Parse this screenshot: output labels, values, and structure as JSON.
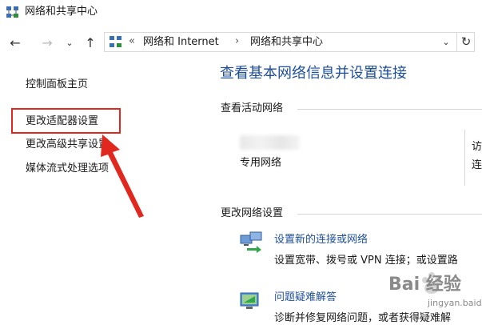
{
  "window": {
    "title": "网络和共享中心"
  },
  "address_bar": {
    "separator": "«",
    "segments": [
      "网络和 Internet",
      "网络和共享中心"
    ],
    "segment_separator": "›"
  },
  "navigation": {
    "back_label": "←",
    "forward_label": "→",
    "recent_label": "⌄",
    "up_label": "↑",
    "dropdown_label": "⌄",
    "refresh_label": "↻"
  },
  "left_pane": {
    "links": [
      "控制面板主页",
      "更改适配器设置",
      "更改高级共享设置",
      "媒体流式处理选项"
    ]
  },
  "main": {
    "title": "查看基本网络信息并设置连接",
    "active_networks_label": "查看活动网络",
    "network_type": "专用网络",
    "right_cut_text": [
      "访",
      "连"
    ],
    "change_settings_label": "更改网络设置",
    "tasks": [
      {
        "icon": "network-setup-icon",
        "link": "设置新的连接或网络",
        "description": "设置宽带、拨号或 VPN 连接；或设置路"
      },
      {
        "icon": "troubleshoot-icon",
        "link": "问题疑难解答",
        "description": "诊断并修复网络问题，或者获得疑难解"
      }
    ]
  },
  "annotation": {
    "highlight_color": "#e0281e",
    "highlighted_link": "更改适配器设置"
  },
  "watermark": {
    "text": "Bai 经验",
    "sub": "jingyan.baidu.com"
  },
  "colors": {
    "link_blue": "#1e4e9a",
    "annotation_red": "#e0281e"
  }
}
